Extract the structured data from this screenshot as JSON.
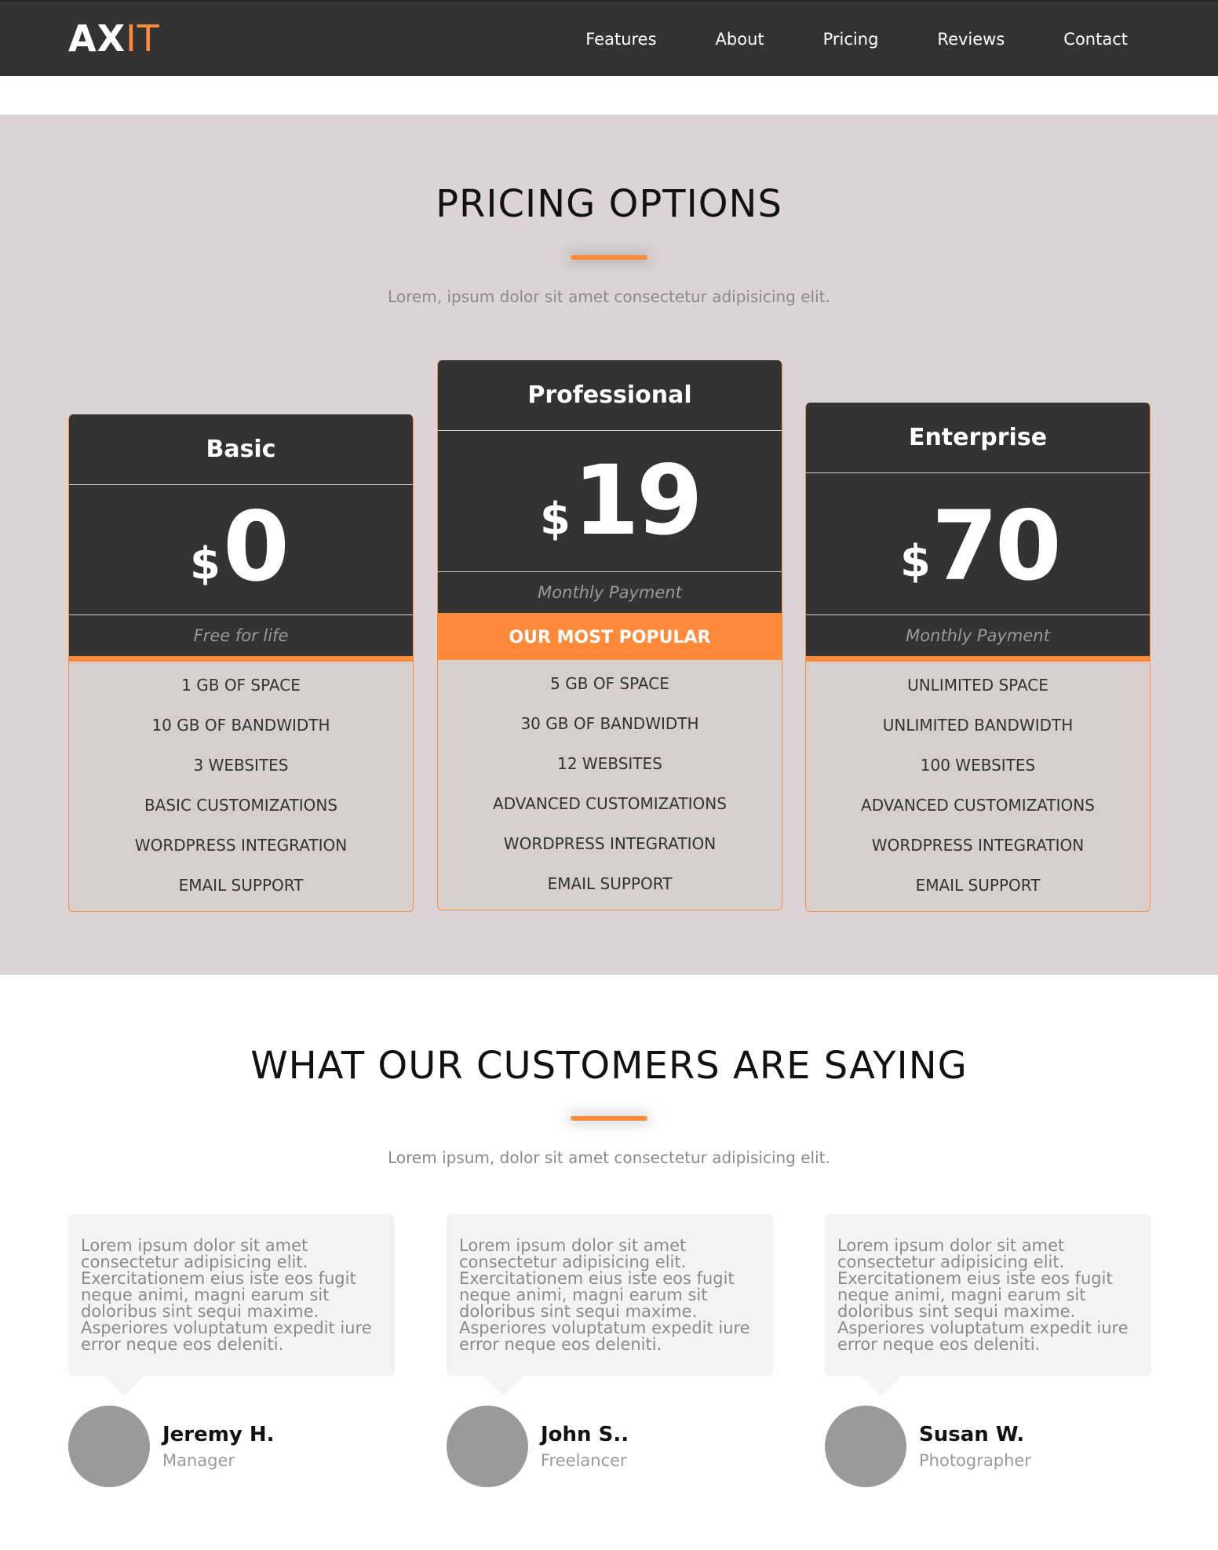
{
  "nav": {
    "logo_part1": "AX",
    "logo_part2": "IT",
    "links": [
      "Features",
      "About",
      "Pricing",
      "Reviews",
      "Contact"
    ]
  },
  "pricing": {
    "title": "PRICING OPTIONS",
    "subtitle": "Lorem, ipsum dolor sit amet consectetur adipisicing elit.",
    "plans": [
      {
        "name": "Basic",
        "currency": "$",
        "price": "0",
        "note": "Free for life",
        "badge": "",
        "features": [
          "1 GB OF SPACE",
          "10 GB OF BANDWIDTH",
          "3 WEBSITES",
          "BASIC CUSTOMIZATIONS",
          "WORDPRESS INTEGRATION",
          "EMAIL SUPPORT"
        ]
      },
      {
        "name": "Professional",
        "currency": "$",
        "price": "19",
        "note": "Monthly Payment",
        "badge": "OUR MOST POPULAR",
        "features": [
          "5 GB OF SPACE",
          "30 GB OF BANDWIDTH",
          "12 WEBSITES",
          "ADVANCED CUSTOMIZATIONS",
          "WORDPRESS INTEGRATION",
          "EMAIL SUPPORT"
        ]
      },
      {
        "name": "Enterprise",
        "currency": "$",
        "price": "70",
        "note": "Monthly Payment",
        "badge": "",
        "features": [
          "UNLIMITED SPACE",
          "UNLIMITED BANDWIDTH",
          "100 WEBSITES",
          "ADVANCED CUSTOMIZATIONS",
          "WORDPRESS INTEGRATION",
          "EMAIL SUPPORT"
        ]
      }
    ]
  },
  "testimonials": {
    "title": "WHAT OUR CUSTOMERS ARE SAYING",
    "subtitle": "Lorem ipsum, dolor sit amet consectetur adipisicing elit.",
    "items": [
      {
        "quote": "Lorem ipsum dolor sit amet consectetur adipisicing elit. Exercitationem eius iste eos fugit neque animi, magni earum sit doloribus sint sequi maxime. Asperiores voluptatum expedit iure error neque eos deleniti.",
        "name": "Jeremy H.",
        "role": "Manager"
      },
      {
        "quote": "Lorem ipsum dolor sit amet consectetur adipisicing elit. Exercitationem eius iste eos fugit neque animi, magni earum sit doloribus sint sequi maxime. Asperiores voluptatum expedit iure error neque eos deleniti.",
        "name": "John S..",
        "role": "Freelancer"
      },
      {
        "quote": "Lorem ipsum dolor sit amet consectetur adipisicing elit. Exercitationem eius iste eos fugit neque animi, magni earum sit doloribus sint sequi maxime. Asperiores voluptatum expedit iure error neque eos deleniti.",
        "name": "Susan W.",
        "role": "Photographer"
      }
    ]
  },
  "colors": {
    "accent": "#ff8a3a",
    "dark": "#333333",
    "pricing_bg": "#dcd4d4"
  }
}
